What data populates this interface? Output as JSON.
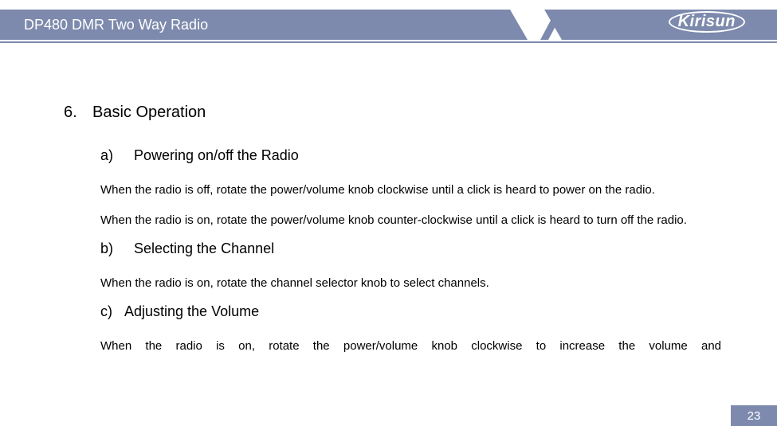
{
  "header": {
    "title": "DP480 DMR Two Way Radio",
    "logo_text": "Kirisun"
  },
  "section": {
    "number": "6.",
    "title": "Basic Operation"
  },
  "subs": {
    "a": {
      "label": "a)",
      "title": "Powering on/off the Radio"
    },
    "b": {
      "label": "b)",
      "title": "Selecting the Channel"
    },
    "c": {
      "label": "c)",
      "title": "Adjusting the Volume"
    }
  },
  "body": {
    "a1": "When the radio is off, rotate the power/volume knob clockwise until a click is heard to power on the radio.",
    "a2": "When the radio is on, rotate the power/volume knob counter-clockwise until a click is heard to turn off the radio.",
    "b1": "When the radio is on, rotate the channel selector knob to select channels.",
    "c1": "When the radio is on, rotate the power/volume knob clockwise to increase the volume and"
  },
  "page_number": "23"
}
